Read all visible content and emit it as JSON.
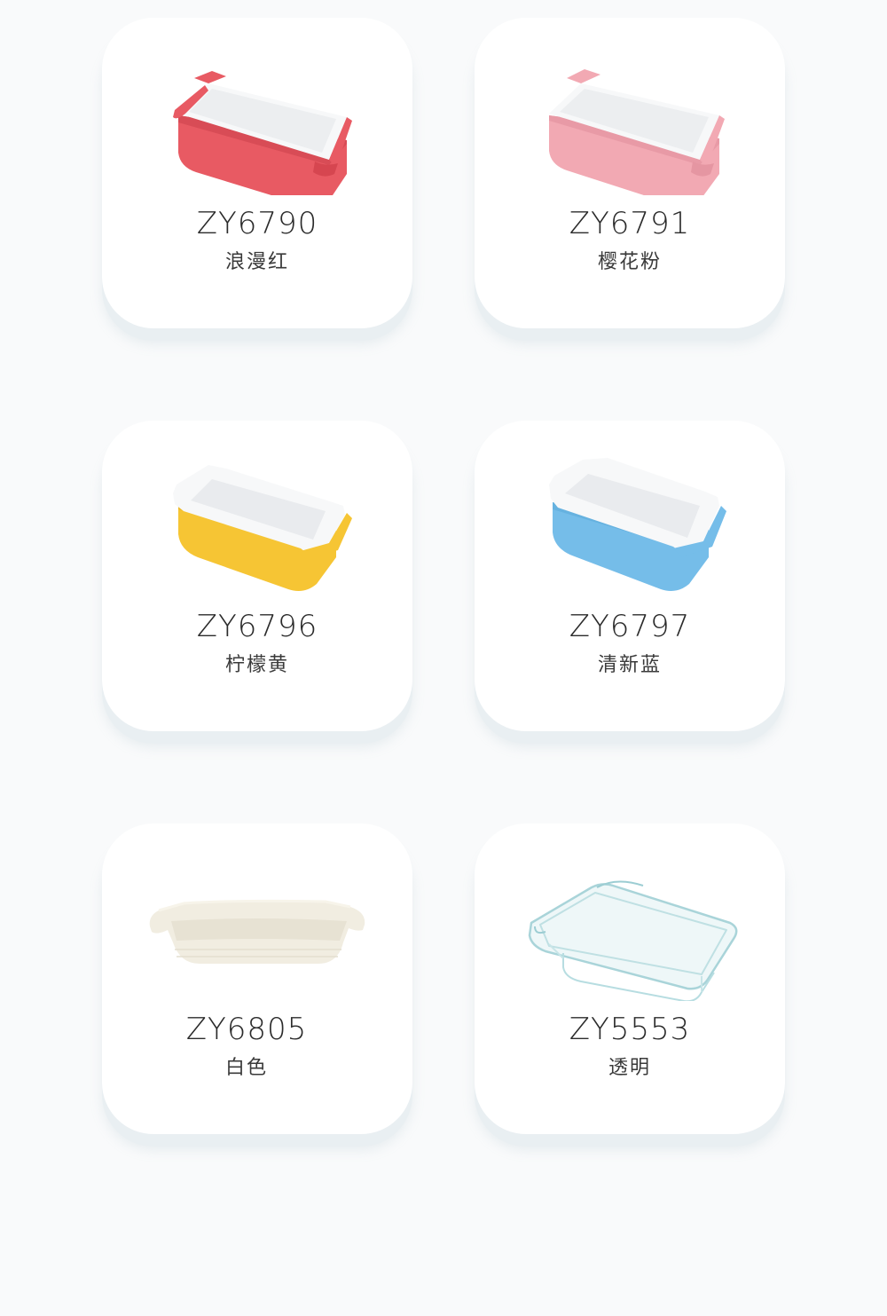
{
  "products": [
    {
      "model": "ZY6790",
      "color_name": "浪漫红",
      "body_color": "#e85a63"
    },
    {
      "model": "ZY6791",
      "color_name": "樱花粉",
      "body_color": "#f2a9b3"
    },
    {
      "model": "ZY6796",
      "color_name": "柠檬黄",
      "body_color": "#f6c534"
    },
    {
      "model": "ZY6797",
      "color_name": "清新蓝",
      "body_color": "#75bde9"
    },
    {
      "model": "ZY6805",
      "color_name": "白色",
      "body_color": "#f1ede1"
    },
    {
      "model": "ZY5553",
      "color_name": "透明",
      "body_color": "#cfe8ea"
    }
  ]
}
